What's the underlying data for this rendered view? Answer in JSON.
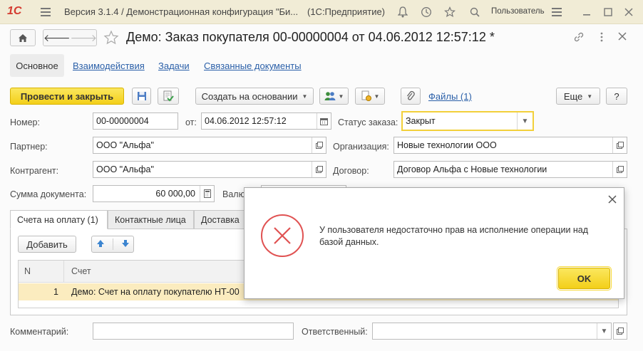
{
  "app": {
    "logo": "1С",
    "title": "Версия 3.1.4 / Демонстрационная конфигурация \"Би...",
    "platform": "(1С:Предприятие)",
    "user": "Пользователь"
  },
  "document": {
    "title": "Демо: Заказ покупателя 00-00000004 от 04.06.2012 12:57:12 *"
  },
  "tabs": {
    "main": "Основное",
    "interactions": "Взаимодействия",
    "tasks": "Задачи",
    "related": "Связанные документы"
  },
  "toolbar": {
    "post_close": "Провести и закрыть",
    "create_based": "Создать на основании",
    "files": "Файлы (1)",
    "more": "Еще",
    "help": "?"
  },
  "form": {
    "number_label": "Номер:",
    "number_value": "00-00000004",
    "date_label": "от:",
    "date_value": "04.06.2012 12:57:12",
    "status_label": "Статус заказа:",
    "status_value": "Закрыт",
    "partner_label": "Партнер:",
    "partner_value": "ООО \"Альфа\"",
    "organization_label": "Организация:",
    "organization_value": "Новые технологии ООО",
    "counterparty_label": "Контрагент:",
    "counterparty_value": "ООО \"Альфа\"",
    "contract_label": "Договор:",
    "contract_value": "Договор Альфа с Новые технологии",
    "sum_label": "Сумма документа:",
    "sum_value": "60 000,00",
    "currency_label": "Валю",
    "comment_label": "Комментарий:",
    "comment_value": "",
    "responsible_label": "Ответственный:",
    "responsible_value": ""
  },
  "inner_tabs": {
    "invoices": "Счета на оплату (1)",
    "contacts": "Контактные лица",
    "delivery": "Доставка"
  },
  "table": {
    "add_button": "Добавить",
    "columns": [
      "N",
      "Счет"
    ],
    "rows": [
      {
        "n": "1",
        "invoice": "Демо: Счет на оплату покупателю НТ-00"
      }
    ]
  },
  "dialog": {
    "message": "У пользователя недостаточно прав на исполнение операции над базой данных.",
    "ok": "OK"
  },
  "colors": {
    "titlebar": "#f1ecd6",
    "accent_yellow": "#f3cf19",
    "link": "#2a5fa8",
    "selected_row": "#fbecbf",
    "error_red": "#e05252"
  }
}
